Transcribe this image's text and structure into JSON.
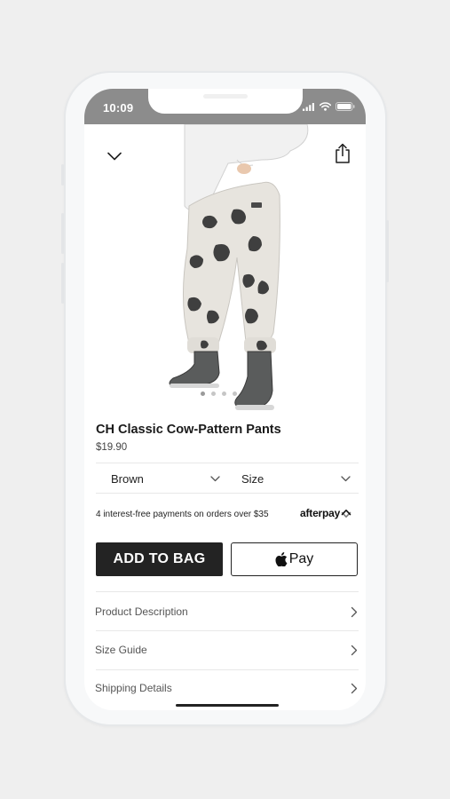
{
  "status_bar": {
    "time": "10:09"
  },
  "product": {
    "title": "CH Classic Cow-Pattern Pants",
    "price": "$19.90"
  },
  "carousel": {
    "count": 4,
    "active_index": 0
  },
  "options": {
    "color": {
      "selected": "Brown"
    },
    "size": {
      "placeholder": "Size"
    }
  },
  "afterpay": {
    "message": "4 interest-free payments on orders over $35",
    "brand": "afterpay"
  },
  "actions": {
    "add_to_bag": "ADD TO BAG",
    "apple_pay": "Pay"
  },
  "details": [
    {
      "label": "Product Description"
    },
    {
      "label": "Size Guide"
    },
    {
      "label": "Shipping Details"
    }
  ],
  "icons": {
    "close": "chevron-down-icon",
    "share": "share-icon",
    "row": "chevron-right-icon"
  },
  "colors": {
    "status_bar": "#8c8c8c",
    "button_dark": "#232323",
    "background": "#efefef"
  }
}
